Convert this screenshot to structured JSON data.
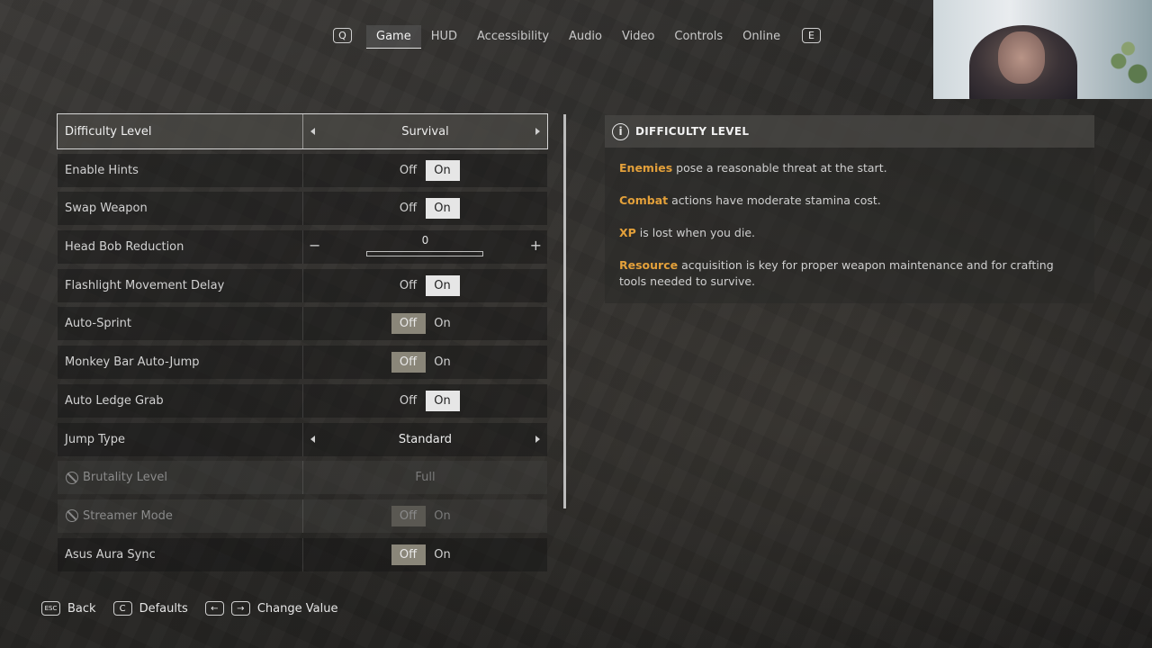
{
  "nav": {
    "prev_key": "Q",
    "next_key": "E",
    "tabs": [
      {
        "label": "Game",
        "active": true
      },
      {
        "label": "HUD",
        "active": false
      },
      {
        "label": "Accessibility",
        "active": false
      },
      {
        "label": "Audio",
        "active": false
      },
      {
        "label": "Video",
        "active": false
      },
      {
        "label": "Controls",
        "active": false
      },
      {
        "label": "Online",
        "active": false
      }
    ]
  },
  "settings": [
    {
      "label": "Difficulty Level",
      "type": "selector",
      "value": "Survival",
      "selected": true
    },
    {
      "label": "Enable Hints",
      "type": "toggle",
      "off": "Off",
      "on": "On",
      "value": "On"
    },
    {
      "label": "Swap Weapon",
      "type": "toggle",
      "off": "Off",
      "on": "On",
      "value": "On"
    },
    {
      "label": "Head Bob Reduction",
      "type": "slider",
      "value": "0",
      "minus": "−",
      "plus": "+"
    },
    {
      "label": "Flashlight Movement Delay",
      "type": "toggle",
      "off": "Off",
      "on": "On",
      "value": "On"
    },
    {
      "label": "Auto-Sprint",
      "type": "toggle",
      "off": "Off",
      "on": "On",
      "value": "Off"
    },
    {
      "label": "Monkey Bar Auto-Jump",
      "type": "toggle",
      "off": "Off",
      "on": "On",
      "value": "Off"
    },
    {
      "label": "Auto Ledge Grab",
      "type": "toggle",
      "off": "Off",
      "on": "On",
      "value": "On"
    },
    {
      "label": "Jump Type",
      "type": "selector",
      "value": "Standard"
    },
    {
      "label": "Brutality Level",
      "type": "disabled-value",
      "value": "Full",
      "disabled": true
    },
    {
      "label": "Streamer Mode",
      "type": "toggle",
      "off": "Off",
      "on": "On",
      "value": "Off",
      "disabled": true
    },
    {
      "label": "Asus Aura Sync",
      "type": "toggle",
      "off": "Off",
      "on": "On",
      "value": "Off"
    }
  ],
  "detail": {
    "title": "DIFFICULTY LEVEL",
    "info_icon": "i",
    "lines": [
      {
        "keyword": "Enemies",
        "text": " pose a reasonable threat at the start."
      },
      {
        "keyword": "Combat",
        "text": " actions have moderate stamina cost."
      },
      {
        "keyword": "XP",
        "text": " is lost when you die."
      },
      {
        "keyword": "Resource",
        "text": " acquisition is key for proper weapon maintenance and for crafting tools needed  to survive."
      }
    ]
  },
  "hints": {
    "back_key": "ESC",
    "back_label": "Back",
    "defaults_key": "C",
    "defaults_label": "Defaults",
    "left_key": "←",
    "right_key": "→",
    "change_label": "Change Value"
  },
  "colors": {
    "accent_keyword": "#e3a03a",
    "toggle_on": "#e6e6e6",
    "toggle_off": "#8a8679"
  }
}
